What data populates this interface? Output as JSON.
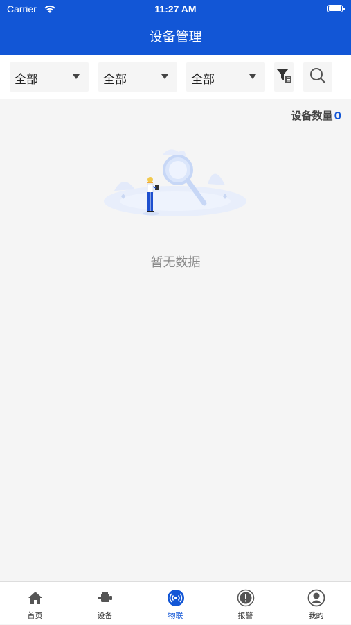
{
  "status_bar": {
    "carrier": "Carrier",
    "time": "11:27 AM"
  },
  "header": {
    "title": "设备管理"
  },
  "filters": [
    {
      "selected": "全部"
    },
    {
      "selected": "全部"
    },
    {
      "selected": "全部"
    }
  ],
  "device_count": {
    "label": "设备数量",
    "value": "0"
  },
  "empty_state": {
    "message": "暂无数据"
  },
  "tabbar": {
    "active": "物联",
    "items": [
      {
        "label": "首页",
        "icon": "home-icon"
      },
      {
        "label": "设备",
        "icon": "device-icon"
      },
      {
        "label": "物联",
        "icon": "iot-signal-icon"
      },
      {
        "label": "报警",
        "icon": "alarm-icon"
      },
      {
        "label": "我的",
        "icon": "user-icon"
      }
    ]
  },
  "colors": {
    "primary": "#1256d6",
    "background": "#f5f5f5",
    "muted_text": "#8a8a8a"
  }
}
